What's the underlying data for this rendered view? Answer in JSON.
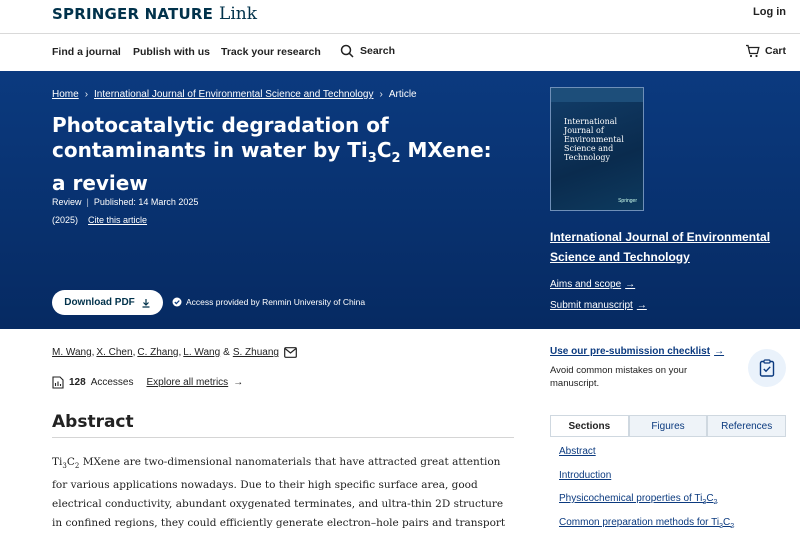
{
  "header": {
    "brand": "SPRINGER NATURE",
    "brand_suffix": "Link",
    "login": "Log in"
  },
  "nav": {
    "items": [
      "Find a journal",
      "Publish with us",
      "Track your research"
    ],
    "search": "Search",
    "cart": "Cart"
  },
  "breadcrumb": [
    "Home",
    "International Journal of Environmental Science and Technology",
    "Article"
  ],
  "article": {
    "title_before": "Photocatalytic degradation of contaminants in water by Ti",
    "title_sub1": "3",
    "title_mid": "C",
    "title_sub2": "2",
    "title_after": " MXene: a review",
    "type": "Review",
    "published": "Published: 14 March 2025",
    "year": "(2025)",
    "cite": "Cite this article",
    "download": "Download PDF",
    "access": "Access provided by Renmin University of China"
  },
  "journal": {
    "cover_title": "International Journal of Environmental Science and Technology",
    "cover_publisher": "Springer",
    "name": "International Journal of Environmental Science and Technology",
    "aims": "Aims and scope",
    "submit": "Submit manuscript"
  },
  "authors": [
    "M. Wang",
    "X. Chen",
    "C. Zhang",
    "L. Wang",
    "S. Zhuang"
  ],
  "metrics": {
    "count": "128",
    "label": "Accesses",
    "explore": "Explore all metrics"
  },
  "abstract": {
    "heading": "Abstract",
    "lead_a": "Ti",
    "lead_sub1": "3",
    "lead_b": "C",
    "lead_sub2": "2",
    "text": " MXene are two-dimensional nanomaterials that have attracted great attention for various applications nowadays. Due to their high specific surface area, good electrical conductivity, abundant oxygenated terminates, and ultra-thin 2D structure in confined regions, they could efficiently generate electron–hole pairs and transport them to the"
  },
  "sidebar": {
    "checklist": "Use our pre-submission checklist",
    "checklist_desc": "Avoid common mistakes on your manuscript.",
    "tabs": [
      "Sections",
      "Figures",
      "References"
    ],
    "toc": [
      "Abstract",
      "Introduction",
      "Physicochemical properties of Ti",
      "Common preparation methods for Ti"
    ],
    "toc_suffix_a": "3",
    "toc_suffix_b": "C",
    "toc_suffix_c": "2"
  },
  "colors": {
    "hero": "#0b3a7f",
    "brand": "#01324b",
    "link": "#0b3a7f"
  }
}
